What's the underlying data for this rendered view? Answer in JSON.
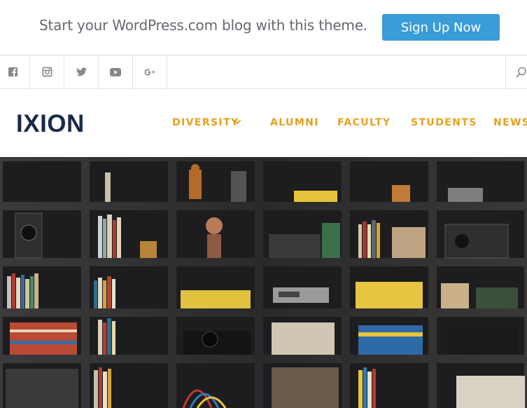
{
  "promo": {
    "text": "Start your WordPress.com blog with this theme.",
    "button_label": "Sign Up Now"
  },
  "social": {
    "icons": [
      "facebook-icon",
      "instagram-icon",
      "twitter-icon",
      "youtube-icon",
      "google-plus-icon",
      "search-icon"
    ]
  },
  "header": {
    "site_title": "IXION",
    "nav": [
      {
        "label": "DIVERSITY",
        "has_dropdown": true
      },
      {
        "label": "ALUMNI"
      },
      {
        "label": "FACULTY"
      },
      {
        "label": "STUDENTS"
      },
      {
        "label": "NEWS"
      }
    ]
  },
  "colors": {
    "accent": "#e8a01f",
    "button": "#3a9cd9",
    "title": "#1b2a4a"
  }
}
